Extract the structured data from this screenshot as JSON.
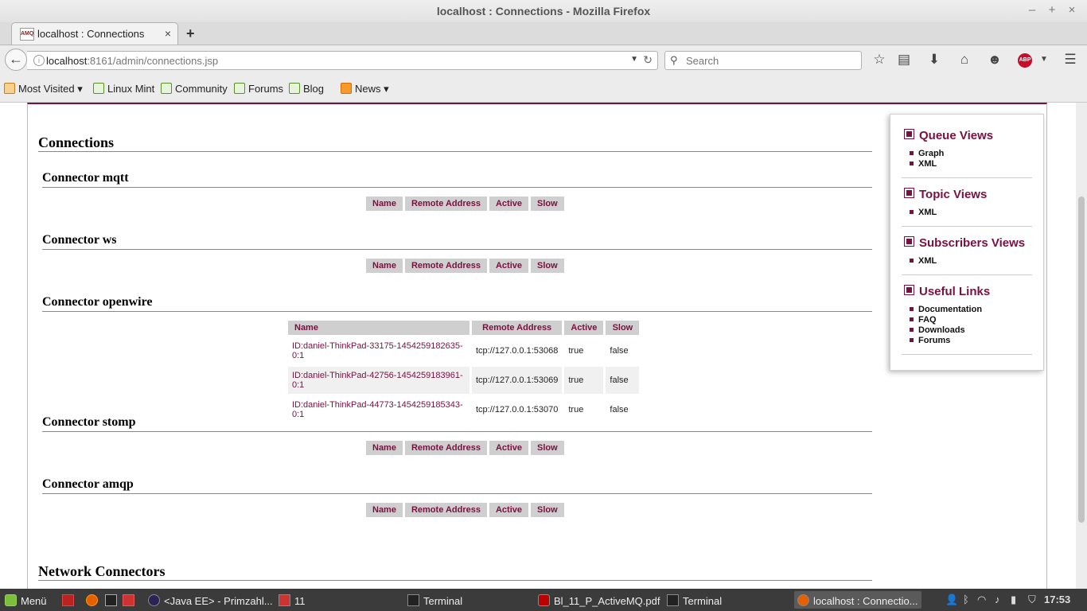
{
  "window": {
    "title": "localhost : Connections - Mozilla Firefox",
    "controls": [
      "–",
      "+",
      "×"
    ]
  },
  "tab": {
    "favicon": "AMQ",
    "label": "localhost : Connections",
    "close": "×",
    "new_tab": "+"
  },
  "nav": {
    "back_icon": "←",
    "url_host": "localhost",
    "url_rest": ":8161/admin/connections.jsp",
    "search_placeholder": "Search",
    "icons": [
      "star-icon",
      "reading-list-icon",
      "download-icon",
      "home-icon",
      "chat-icon",
      "adblock-icon",
      "menu-icon"
    ]
  },
  "bookmarks": [
    {
      "label": "Most Visited",
      "icon": "folder-icon",
      "dropdown": true
    },
    {
      "label": "Linux Mint",
      "icon": "mint-icon"
    },
    {
      "label": "Community",
      "icon": "mint-icon"
    },
    {
      "label": "Forums",
      "icon": "mint-icon"
    },
    {
      "label": "Blog",
      "icon": "mint-icon"
    },
    {
      "label": "News",
      "icon": "rss-icon",
      "dropdown": true
    }
  ],
  "page": {
    "connections_heading": "Connections",
    "network_heading": "Network Connectors",
    "columns": [
      "Name",
      "Remote Address",
      "Active",
      "Slow"
    ],
    "connectors": [
      {
        "title": "Connector mqtt",
        "rows": []
      },
      {
        "title": "Connector ws",
        "rows": []
      },
      {
        "title": "Connector openwire",
        "rows": [
          {
            "name": "ID:daniel-ThinkPad-33175-1454259182635-0:1",
            "remote": "tcp://127.0.0.1:53068",
            "active": "true",
            "slow": "false"
          },
          {
            "name": "ID:daniel-ThinkPad-42756-1454259183961-0:1",
            "remote": "tcp://127.0.0.1:53069",
            "active": "true",
            "slow": "false"
          },
          {
            "name": "ID:daniel-ThinkPad-44773-1454259185343-0:1",
            "remote": "tcp://127.0.0.1:53070",
            "active": "true",
            "slow": "false"
          }
        ]
      },
      {
        "title": "Connector stomp",
        "rows": []
      },
      {
        "title": "Connector amqp",
        "rows": []
      }
    ]
  },
  "sidebar": {
    "queue_views": {
      "title": "Queue Views",
      "items": [
        "Graph",
        "XML"
      ]
    },
    "topic_views": {
      "title": "Topic Views",
      "items": [
        "XML"
      ]
    },
    "subscribers_views": {
      "title": "Subscribers Views",
      "items": [
        "XML"
      ]
    },
    "useful_links": {
      "title": "Useful Links",
      "items": [
        "Documentation",
        "FAQ",
        "Downloads",
        "Forums"
      ]
    }
  },
  "taskbar": {
    "menu_label": "Menü",
    "windows": [
      "<Java EE> - Primzahl...",
      "11",
      "Terminal",
      "Bl_11_P_ActiveMQ.pdf",
      "Terminal",
      "localhost : Connectio..."
    ],
    "clock": "17:53"
  }
}
